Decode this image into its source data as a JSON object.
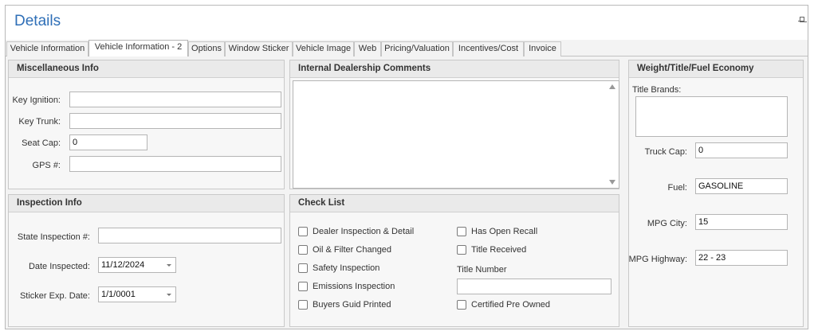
{
  "header": {
    "title": "Details"
  },
  "tabs": [
    "Vehicle Information",
    "Vehicle Information - 2",
    "Options",
    "Window Sticker",
    "Vehicle Image",
    "Web",
    "Pricing/Valuation",
    "Incentives/Cost",
    "Invoice"
  ],
  "active_tab": "Vehicle Information - 2",
  "misc": {
    "title": "Miscellaneous Info",
    "key_ignition_label": "Key Ignition:",
    "key_ignition_value": "",
    "key_trunk_label": "Key Trunk:",
    "key_trunk_value": "",
    "seat_cap_label": "Seat Cap:",
    "seat_cap_value": "0",
    "gps_label": "GPS #:",
    "gps_value": ""
  },
  "comments": {
    "title": "Internal Dealership Comments",
    "value": ""
  },
  "weight": {
    "title": "Weight/Title/Fuel Economy",
    "title_brands_label": "Title Brands:",
    "title_brands_value": "",
    "truck_cap_label": "Truck Cap:",
    "truck_cap_value": "0",
    "fuel_label": "Fuel:",
    "fuel_value": "GASOLINE",
    "mpg_city_label": "MPG City:",
    "mpg_city_value": "15",
    "mpg_highway_label": "MPG Highway:",
    "mpg_highway_value": "22 - 23"
  },
  "inspection": {
    "title": "Inspection Info",
    "state_inspection_label": "State Inspection #:",
    "state_inspection_value": "",
    "date_inspected_label": "Date Inspected:",
    "date_inspected_value": "11/12/2024",
    "sticker_exp_label": "Sticker Exp. Date:",
    "sticker_exp_value": "1/1/0001"
  },
  "checklist": {
    "title": "Check List",
    "dealer_inspection": "Dealer Inspection & Detail",
    "oil_filter": "Oil & Filter Changed",
    "safety_inspection": "Safety Inspection",
    "emissions_inspection": "Emissions Inspection",
    "buyers_guid": "Buyers Guid Printed",
    "has_open_recall": "Has Open Recall",
    "title_received": "Title Received",
    "title_number_label": "Title Number",
    "title_number_value": "",
    "certified_pre_owned": "Certified Pre Owned"
  }
}
